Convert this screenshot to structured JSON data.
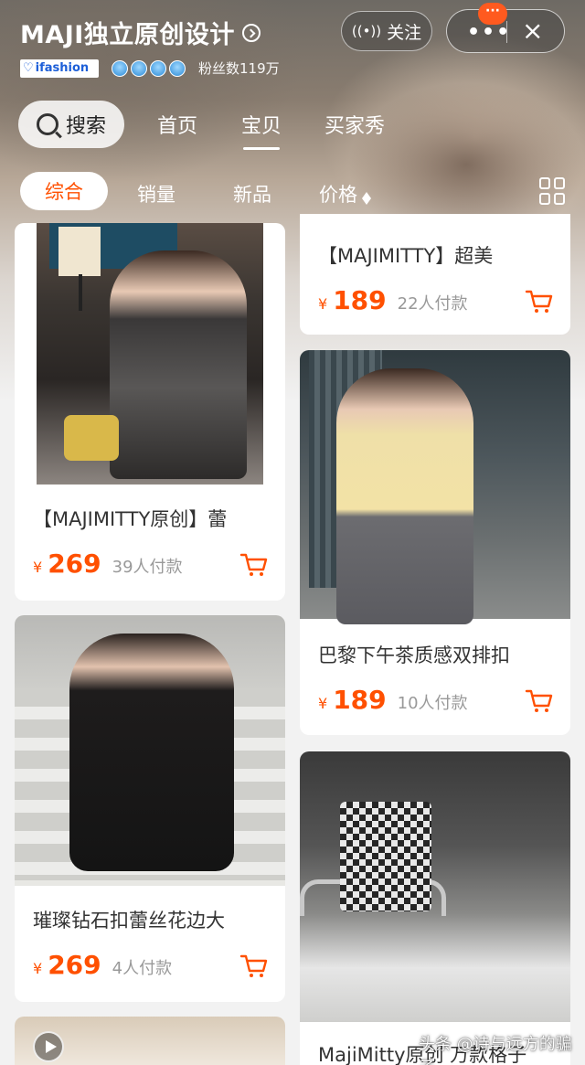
{
  "header": {
    "shop_name": "MAJI独立原创设计",
    "badge": "ifashion",
    "fans": "粉丝数119万",
    "follow_label": "关注",
    "more_icon": "more-dots-icon",
    "close_label": "×",
    "notif_label": "···"
  },
  "nav": {
    "search_label": "搜索",
    "tabs": [
      {
        "label": "首页"
      },
      {
        "label": "宝贝"
      },
      {
        "label": "买家秀"
      }
    ],
    "active_tab": "宝贝"
  },
  "filters": {
    "items": [
      {
        "label": "综合"
      },
      {
        "label": "销量"
      },
      {
        "label": "新品"
      },
      {
        "label": "价格"
      }
    ],
    "active": "综合"
  },
  "products": [
    {
      "title": "【MAJIMITTY原创】蕾",
      "currency": "¥",
      "price": "269",
      "sold": "39人付款"
    },
    {
      "title": "【MAJIMITTY】超美",
      "currency": "¥",
      "price": "189",
      "sold": "22人付款"
    },
    {
      "title": "巴黎下午茶质感双排扣",
      "currency": "¥",
      "price": "189",
      "sold": "10人付款"
    },
    {
      "title": "璀璨钻石扣蕾丝花边大",
      "currency": "¥",
      "price": "269",
      "sold": "4人付款"
    },
    {
      "title": "MajiMitty原创 万款格子",
      "currency": "",
      "price": "",
      "sold": ""
    }
  ],
  "watermark": "头条 @诗与远方的骗子",
  "colors": {
    "accent": "#ff5000",
    "background": "#f2f2f2"
  }
}
